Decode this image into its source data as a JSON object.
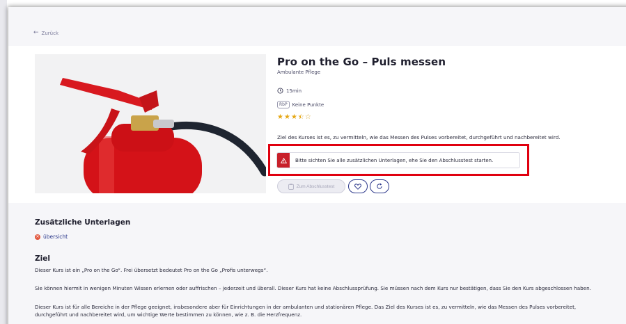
{
  "nav": {
    "back_label": "Zurück"
  },
  "course": {
    "title": "Pro on the Go – Puls messen",
    "category": "Ambulante Pflege",
    "duration": "15min",
    "points_badge": "RbP",
    "points_text": "Keine Punkte",
    "rating": {
      "value": 3.5,
      "max": 5
    },
    "description": "Ziel des Kurses ist es, zu vermitteln, wie das Messen des Pulses vorbereitet, durchgeführt und nachbereitet wird."
  },
  "alert": {
    "text": "Bitte sichten Sie alle zusätzlichen Unterlagen, ehe Sie den Abschlusstest starten.",
    "color": "#c8202a"
  },
  "actions": {
    "exam_label": "Zum Abschlusstest",
    "exam_enabled": false
  },
  "extra_docs": {
    "heading": "Zusätzliche Unterlagen",
    "overview_link": "übersicht"
  },
  "goal": {
    "heading": "Ziel",
    "p1": "Dieser Kurs ist ein „Pro on the Go“. Frei übersetzt bedeutet Pro on the Go „Profis unterwegs“.",
    "p2": "Sie können hiermit in wenigen Minuten Wissen erlernen oder auffrischen – jederzeit und überall. Dieser Kurs hat keine Abschlussprüfung. Sie müssen nach dem Kurs nur bestätigen, dass Sie den Kurs abgeschlossen haben.",
    "p3a": "Dieser Kurs ist für alle Bereiche in der Pflege geeignet, insbesondere aber für Einrichtungen in der ambulanten und stationären Pflege. Das Ziel des Kurses ist es, zu vermitteln, wie das Messen des Pulses vorbereitet,",
    "p3b": "durchgeführt und nachbereitet wird, um wichtige Werte bestimmen zu können, wie z. B. die Herzfrequenz."
  },
  "colors": {
    "highlight_border": "#e0000f",
    "link": "#2d3a8c",
    "star": "#e6a817"
  }
}
